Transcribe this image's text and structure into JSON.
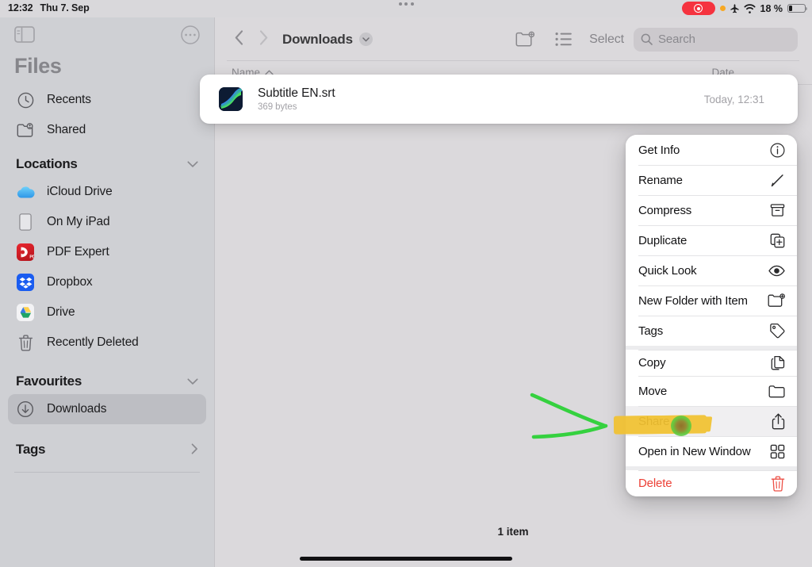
{
  "status_bar": {
    "time": "12:32",
    "date": "Thu 7. Sep",
    "battery_percent": "18 %",
    "icons": {
      "recording": "screen-recording-pill-icon",
      "privacy_dot": "orange-privacy-dot-icon",
      "airplane": "airplane-mode-icon",
      "wifi": "wifi-icon",
      "battery": "battery-low-icon",
      "multitask": "multitasking-dots-icon"
    },
    "colors": {
      "recording_red": "#f5333f",
      "privacy_orange": "#f7a823"
    }
  },
  "sidebar": {
    "title": "Files",
    "toggle_icon": "sidebar-toggle-icon",
    "more_icon": "ellipsis-circle-icon",
    "top_items": [
      {
        "label": "Recents",
        "icon": "clock-icon"
      },
      {
        "label": "Shared",
        "icon": "shared-folder-icon"
      }
    ],
    "sections": [
      {
        "header": "Locations",
        "chevron": "chevron-down-icon",
        "items": [
          {
            "label": "iCloud Drive",
            "icon": "icloud-drive-icon"
          },
          {
            "label": "On My iPad",
            "icon": "ipad-icon"
          },
          {
            "label": "PDF Expert",
            "icon": "pdf-expert-app-icon"
          },
          {
            "label": "Dropbox",
            "icon": "dropbox-app-icon"
          },
          {
            "label": "Drive",
            "icon": "google-drive-app-icon"
          },
          {
            "label": "Recently Deleted",
            "icon": "trash-icon"
          }
        ]
      },
      {
        "header": "Favourites",
        "chevron": "chevron-down-icon",
        "items": [
          {
            "label": "Downloads",
            "icon": "download-circle-icon",
            "selected": true
          }
        ]
      },
      {
        "header": "Tags",
        "chevron": "chevron-right-icon",
        "items": []
      }
    ]
  },
  "toolbar": {
    "back_icon": "chevron-left-icon",
    "forward_icon": "chevron-right-icon",
    "breadcrumb": "Downloads",
    "breadcrumb_chevron": "chevron-down-icon",
    "new_folder_icon": "new-folder-icon",
    "view_options_icon": "list-view-icon",
    "select_label": "Select",
    "search_placeholder": "Search",
    "search_icon": "search-icon"
  },
  "columns": {
    "name": "Name",
    "name_sort_icon": "chevron-up-icon",
    "date": "Date"
  },
  "file": {
    "name": "Subtitle EN.srt",
    "size": "369 bytes",
    "date": "Today, 12:31",
    "icon": "subtitle-file-icon"
  },
  "context_menu": {
    "items": [
      {
        "label": "Get Info",
        "icon": "info-circle-icon",
        "group": 0
      },
      {
        "label": "Rename",
        "icon": "pencil-icon",
        "group": 0
      },
      {
        "label": "Compress",
        "icon": "archive-box-icon",
        "group": 0
      },
      {
        "label": "Duplicate",
        "icon": "duplicate-icon",
        "group": 0
      },
      {
        "label": "Quick Look",
        "icon": "eye-icon",
        "group": 0
      },
      {
        "label": "New Folder with Item",
        "icon": "new-folder-icon",
        "group": 0
      },
      {
        "label": "Tags",
        "icon": "tag-icon",
        "group": 0
      },
      {
        "label": "Copy",
        "icon": "copy-icon",
        "group": 1
      },
      {
        "label": "Move",
        "icon": "folder-icon",
        "group": 1
      },
      {
        "label": "Share",
        "icon": "share-icon",
        "group": 1,
        "highlighted": true
      },
      {
        "label": "Open in New Window",
        "icon": "new-window-icon",
        "group": 1
      },
      {
        "label": "Delete",
        "icon": "trash-icon",
        "group": 2,
        "destructive": true
      }
    ]
  },
  "annotations": {
    "highlight_color": "#f2c231",
    "arrow_color": "#35d13f",
    "target_label": "Share",
    "arrow_icon": "hand-drawn-arrow-icon",
    "dot_icon": "tap-target-dot-icon"
  },
  "footer": {
    "item_count": "1 item"
  }
}
